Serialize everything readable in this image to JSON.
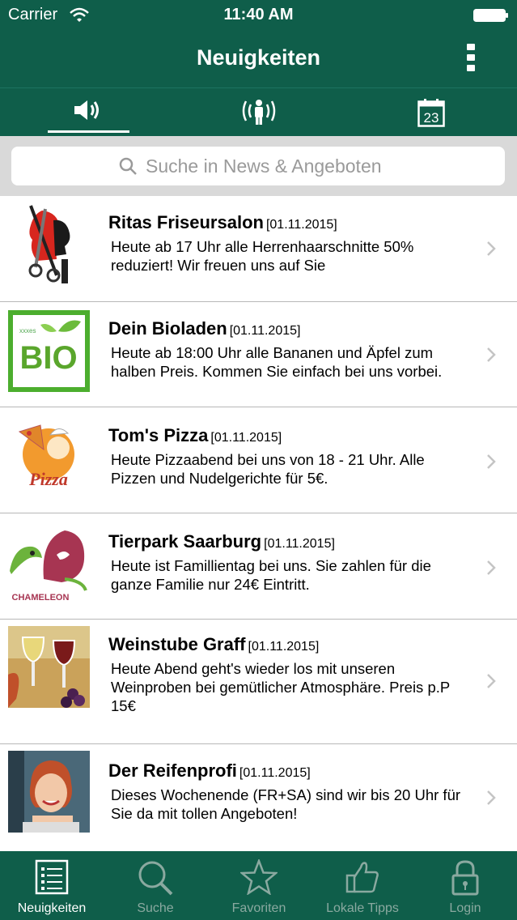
{
  "status": {
    "carrier": "Carrier",
    "time": "11:40 AM"
  },
  "header": {
    "title": "Neuigkeiten"
  },
  "tabs": [
    {
      "icon": "speaker-icon"
    },
    {
      "icon": "person-broadcast-icon"
    },
    {
      "icon": "calendar-icon",
      "day": "23"
    }
  ],
  "search": {
    "placeholder": "Suche in News & Angeboten"
  },
  "news": [
    {
      "title": "Ritas Friseursalon",
      "date": "[01.11.2015]",
      "text": "Heute ab 17 Uhr alle Herrenhaarschnitte 50% reduziert! Wir freuen uns auf Sie"
    },
    {
      "title": "Dein Bioladen",
      "date": "[01.11.2015]",
      "text": "Heute ab 18:00 Uhr alle Bananen und Äpfel zum halben Preis. Kommen Sie einfach bei uns vorbei.",
      "logo_text": "BIO",
      "logo_small": "xxxes"
    },
    {
      "title": "Tom's Pizza",
      "date": "[01.11.2015]",
      "text": "Heute Pizzaabend bei uns von 18 - 21 Uhr. Alle Pizzen und Nudelgerichte für 5€.",
      "logo_text": "Pizza"
    },
    {
      "title": "Tierpark Saarburg",
      "date": "[01.11.2015]",
      "text": "Heute ist Famillientag bei uns. Sie zahlen für die ganze Familie nur 24€ Eintritt.",
      "logo_text": "CHAMELEON"
    },
    {
      "title": "Weinstube Graff",
      "date": "[01.11.2015]",
      "text": "Heute Abend geht's wieder los mit unseren Weinproben bei gemütlicher Atmosphäre. Preis p.P 15€"
    },
    {
      "title": "Der Reifenprofi",
      "date": "[01.11.2015]",
      "text": "Dieses Wochenende (FR+SA) sind wir bis 20 Uhr für Sie da mit tollen Angeboten!"
    }
  ],
  "tabbar": [
    {
      "label": "Neuigkeiten",
      "icon": "list-icon",
      "active": true
    },
    {
      "label": "Suche",
      "icon": "search-icon"
    },
    {
      "label": "Favoriten",
      "icon": "star-icon"
    },
    {
      "label": "Lokale Tipps",
      "icon": "thumbs-up-icon"
    },
    {
      "label": "Login",
      "icon": "lock-icon"
    }
  ],
  "colors": {
    "primary": "#0f5e4a",
    "search_bg": "#d9d9d9",
    "inactive": "#8aa9a0"
  }
}
